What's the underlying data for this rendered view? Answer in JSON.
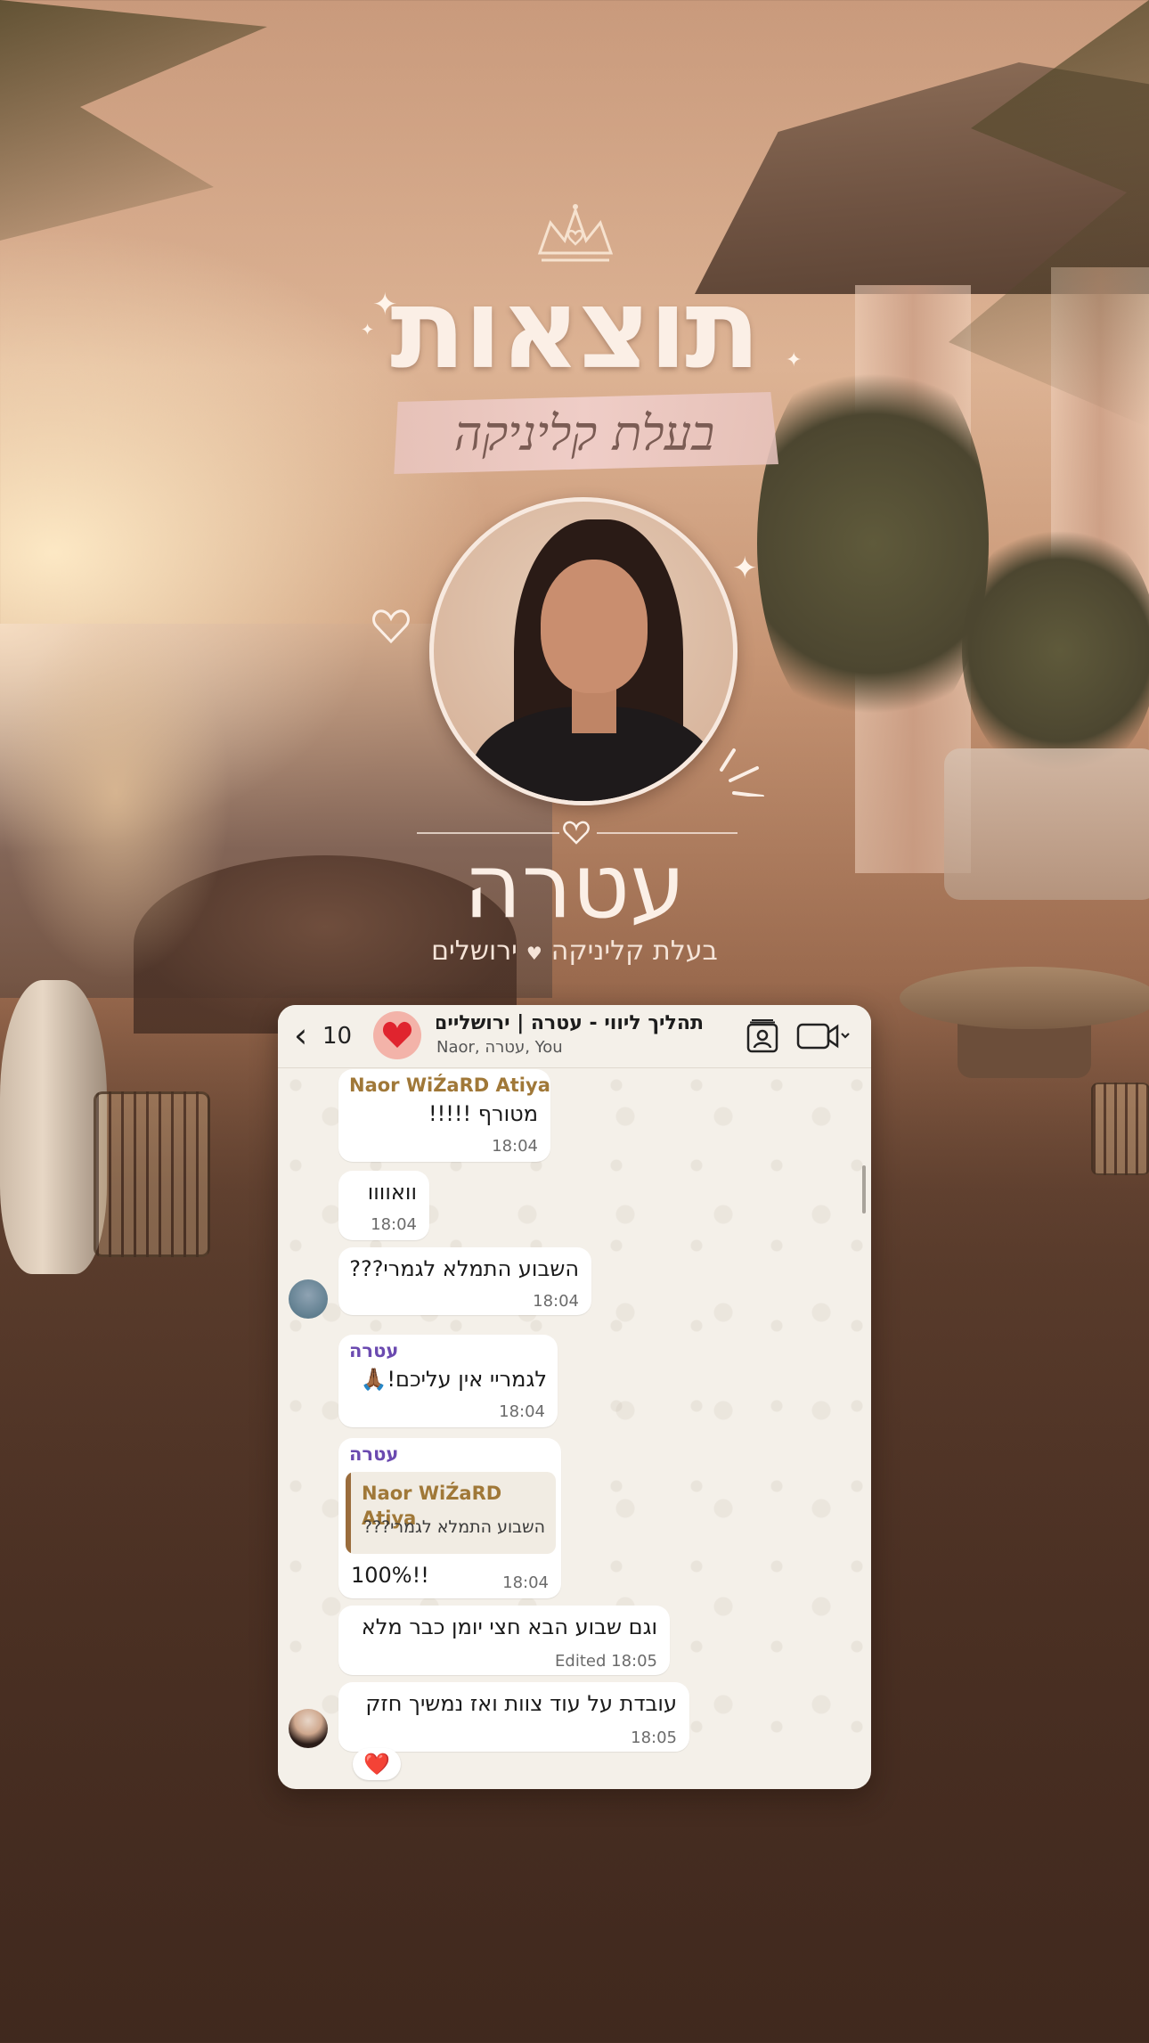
{
  "headline": {
    "title": "תוצאות",
    "ribbon": "בעלת קליניקה"
  },
  "profile": {
    "name": "עטרה",
    "subtitle_role": "בעלת קליניקה",
    "subtitle_sep": "♥",
    "subtitle_city": "ירושלים"
  },
  "chat": {
    "header": {
      "back_icon": "chevron-left-icon",
      "back_count": "10",
      "avatar_emoji": "❤️",
      "title": "תהליך ליווי - עטרה | ירושליים...",
      "members": "Naor, עטרה, You",
      "contact_icon": "contact-card-icon",
      "video_icon": "video-call-icon"
    },
    "messages": [
      {
        "sender": "Naor WiŹaRD Atiya",
        "text": "מטורף !!!!!",
        "time": "18:04"
      },
      {
        "text": "וואוווו",
        "time": "18:04"
      },
      {
        "text": "השבוע התמלא לגמרי???",
        "time": "18:04"
      },
      {
        "sender": "עטרה",
        "text": "לגמריי אין עליכם!🙏🏾",
        "time": "18:04"
      },
      {
        "sender": "עטרה",
        "quote_sender": "Naor WiŹaRD Atiya",
        "quote_text": "השבוע התמלא לגמרי???",
        "text": "100%!!",
        "time": "18:04"
      },
      {
        "text": "וגם שבוע הבא חצי יומן כבר מלא",
        "time": "Edited 18:05"
      },
      {
        "text": "עובדת על עוד צוות ואז נמשיך חזק",
        "time": "18:05",
        "reaction": "❤️"
      }
    ],
    "colors": {
      "naor_name": "#a07838",
      "atara_name": "#6b4ab0",
      "bubble": "#ffffff",
      "chat_bg": "#f4f0e9"
    }
  }
}
